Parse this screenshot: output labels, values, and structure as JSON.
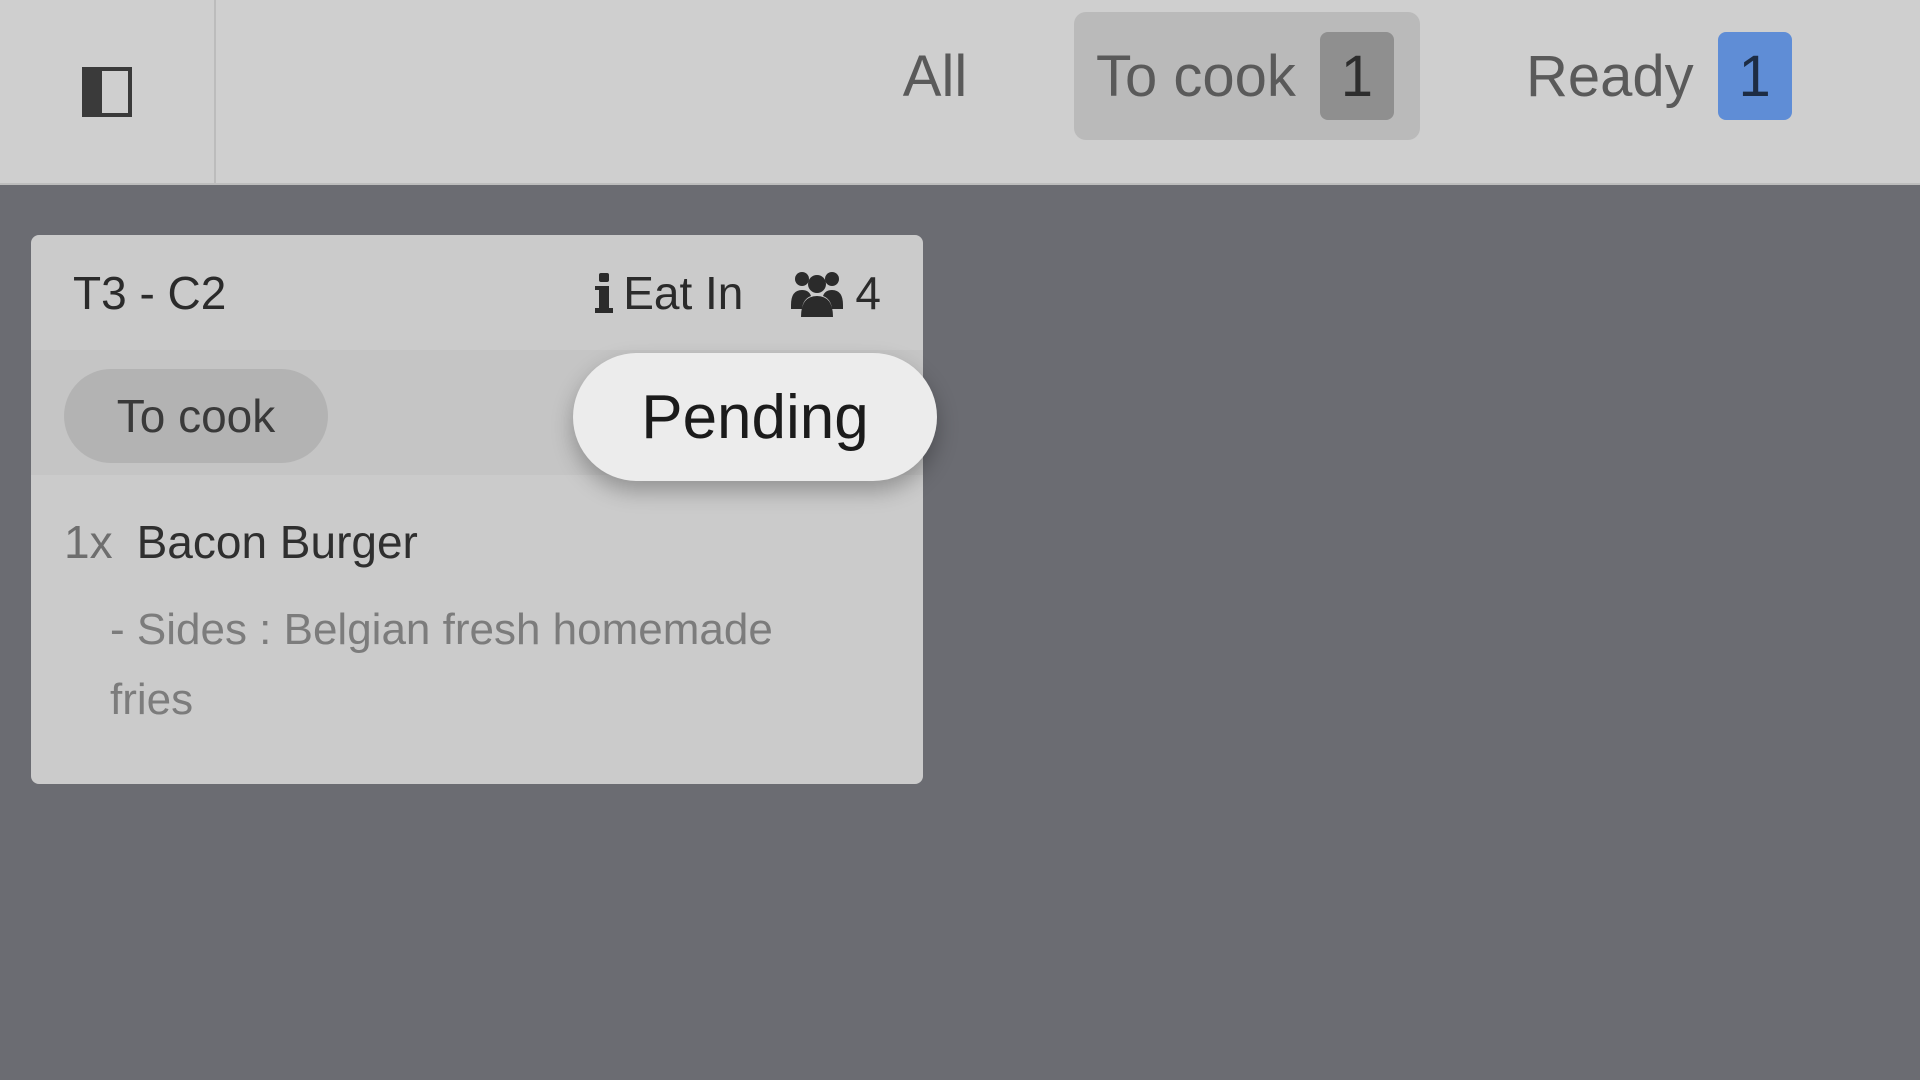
{
  "topbar": {
    "sidebar_toggle_icon": "sidebar-panel-icon",
    "tabs": [
      {
        "label": "All"
      },
      {
        "label": "To cook",
        "count": "1",
        "badge_color": "#8f8f8f",
        "active": true
      },
      {
        "label": "Ready",
        "count": "1",
        "badge_color": "#5f8dd6"
      }
    ]
  },
  "order": {
    "title": "T3 - C2",
    "service_type": "Eat In",
    "guests": "4",
    "status": "To cook",
    "popup_action": "Pending",
    "items": [
      {
        "qty": "1x",
        "name": "Bacon Burger",
        "modifier": "- Sides : Belgian fresh homemade fries"
      }
    ]
  },
  "colors": {
    "background": "#6b6c72",
    "topbar": "#cfcfcf",
    "card": "#cbcbcb",
    "accent_blue": "#5f8dd6"
  }
}
